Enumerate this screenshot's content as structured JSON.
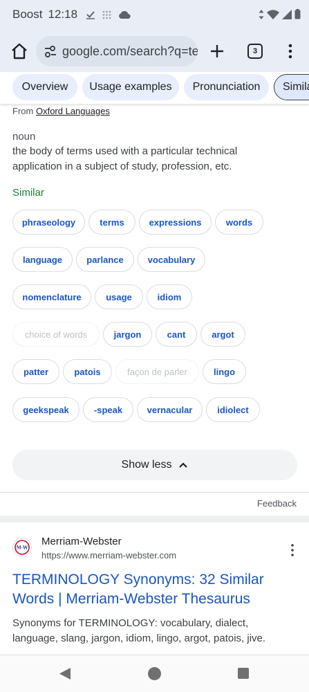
{
  "status_bar": {
    "carrier": "Boost",
    "time": "12:18"
  },
  "browser": {
    "url": "google.com/search?q=te",
    "tab_count": "3"
  },
  "tabs": [
    "Overview",
    "Usage examples",
    "Pronunciation",
    "Simila"
  ],
  "definition": {
    "source_prefix": "From",
    "source": "Oxford Languages",
    "part_of_speech": "noun",
    "text": "the body of terms used with a particular technical application in a subject of study, profession, etc."
  },
  "similar": {
    "title": "Similar",
    "words": [
      "phraseology",
      "terms",
      "expressions",
      "words",
      "language",
      "parlance",
      "vocabulary",
      "nomenclature",
      "usage",
      "idiom",
      "choice of words",
      "jargon",
      "cant",
      "argot",
      "patter",
      "patois",
      "façon de parler",
      "lingo",
      "geekspeak",
      "-speak",
      "vernacular",
      "idiolect"
    ]
  },
  "show_less": "Show less",
  "feedback": "Feedback",
  "result": {
    "favicon_text": "M·W",
    "site_name": "Merriam-Webster",
    "site_url": "https://www.merriam-webster.com",
    "title": "TERMINOLOGY Synonyms: 32 Similar Words | Merriam-Webster Thesaurus",
    "snippet": "Synonyms for TERMINOLOGY: vocabulary, dialect, language, slang, jargon, idiom, lingo, argot, patois, jive."
  },
  "colors": {
    "link": "#1a56c4",
    "similar_green": "#188038",
    "muted_chip": "#bdc1c6"
  },
  "icons": [
    "check-icon",
    "grid-icon",
    "cloud-icon",
    "wifi-icon",
    "signal-icon",
    "battery-icon",
    "home-icon",
    "tune-icon",
    "plus-icon",
    "more-vert-icon",
    "chevron-up-icon",
    "back-icon"
  ]
}
